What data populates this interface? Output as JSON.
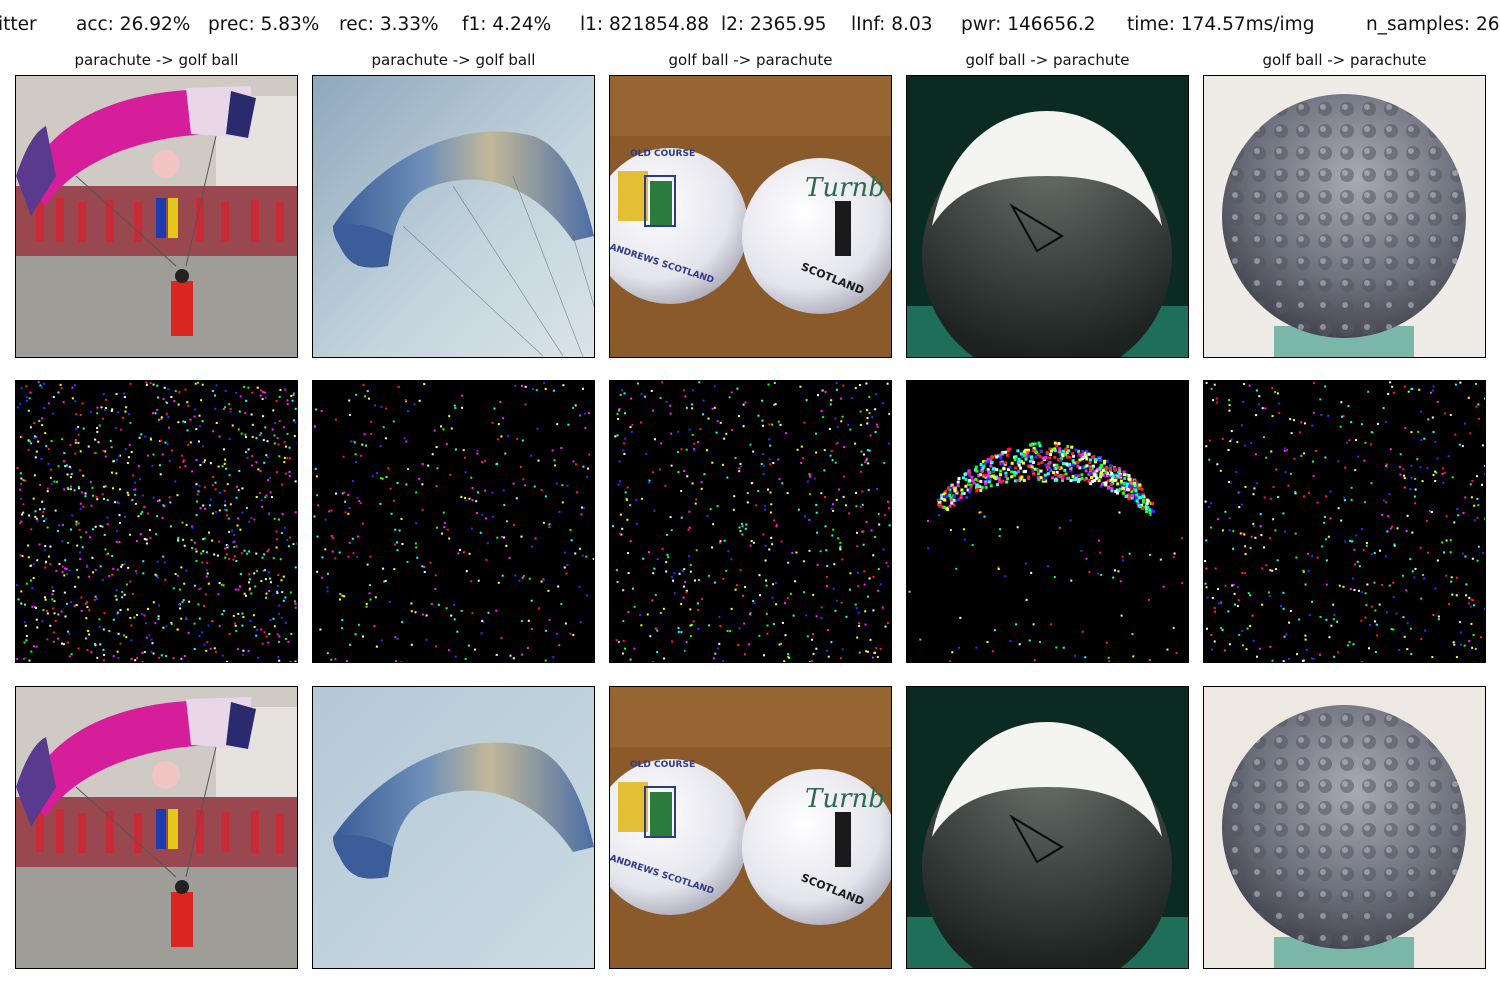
{
  "header": {
    "method": "itter",
    "acc": "acc: 26.92%",
    "prec": "prec: 5.83%",
    "rec": "rec: 3.33%",
    "f1": "f1: 4.24%",
    "l1": "l1: 821854.88",
    "l2": "l2: 2365.95",
    "linf": "lInf: 8.03",
    "pwr": "pwr: 146656.2",
    "time": "time: 174.57ms/img",
    "n_samples": "n_samples: 26"
  },
  "columns": [
    {
      "caption": "parachute -> golf ball"
    },
    {
      "caption": "parachute -> golf ball"
    },
    {
      "caption": "golf ball -> parachute"
    },
    {
      "caption": "golf ball -> parachute"
    },
    {
      "caption": "golf ball -> parachute"
    }
  ],
  "ball_text": {
    "ball1_top": "OLD COURSE",
    "ball1_bottom": "ANDREWS SCOTLAND",
    "ball2_brand": "Turnb",
    "ball2_bottom": "SCOTLAND"
  },
  "colors": {
    "noise_background": "#000000",
    "parachute_pink": "#d61d9a",
    "parachute_blue": "#3b5fa0",
    "golf_bg_wood": "#8a5a2b",
    "dark_green_bg": "#0b2a22"
  }
}
